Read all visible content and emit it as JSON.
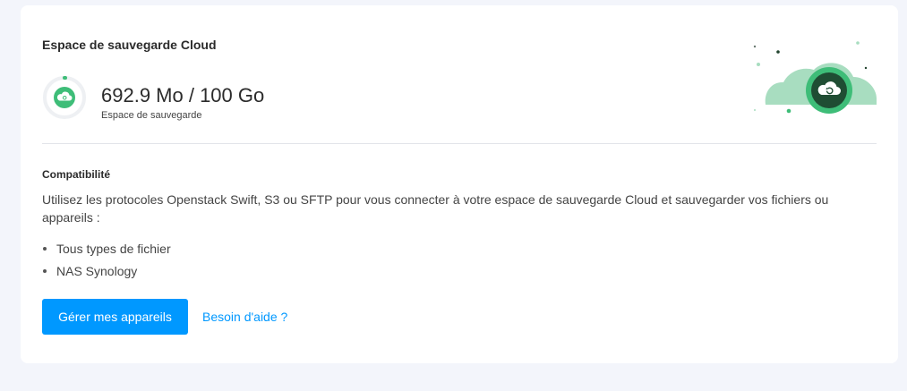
{
  "card": {
    "title": "Espace de sauvegarde Cloud"
  },
  "usage": {
    "value": "692.9 Mo / 100 Go",
    "label": "Espace de sauvegarde",
    "fraction": 0.0069,
    "icon": "cloud-backup-icon",
    "accent_color": "#3ebd78"
  },
  "illustration": {
    "icon": "cloud-restore-icon"
  },
  "compatibility": {
    "title": "Compatibilité",
    "description": "Utilisez les protocoles Openstack Swift, S3 ou SFTP pour vous connecter à votre espace de sauvegarde Cloud et sauvegarder vos fichiers ou appareils :",
    "items": [
      "Tous types de fichier",
      "NAS Synology"
    ]
  },
  "actions": {
    "primary_label": "Gérer mes appareils",
    "primary_color": "#0098ff",
    "help_label": "Besoin d'aide ?"
  }
}
